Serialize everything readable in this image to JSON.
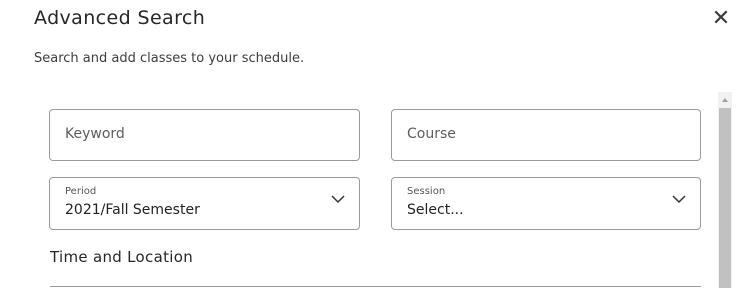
{
  "dialog": {
    "title": "Advanced Search",
    "subtitle": "Search and add classes to your schedule.",
    "close_icon": "close-icon"
  },
  "form": {
    "keyword": {
      "placeholder": "Keyword",
      "value": ""
    },
    "course": {
      "placeholder": "Course",
      "value": ""
    },
    "period": {
      "label": "Period",
      "value": "2021/Fall Semester"
    },
    "session": {
      "label": "Session",
      "value": "Select..."
    },
    "section_title": "Time and Location"
  },
  "icons": {
    "dropdown": "chevron-down-icon",
    "scroll_up": "scroll-up-arrow-icon"
  },
  "colors": {
    "border": "#9a9a9a",
    "scrollbar_thumb": "#c1c1c1",
    "scrollbar_track": "#f1f1f1"
  }
}
